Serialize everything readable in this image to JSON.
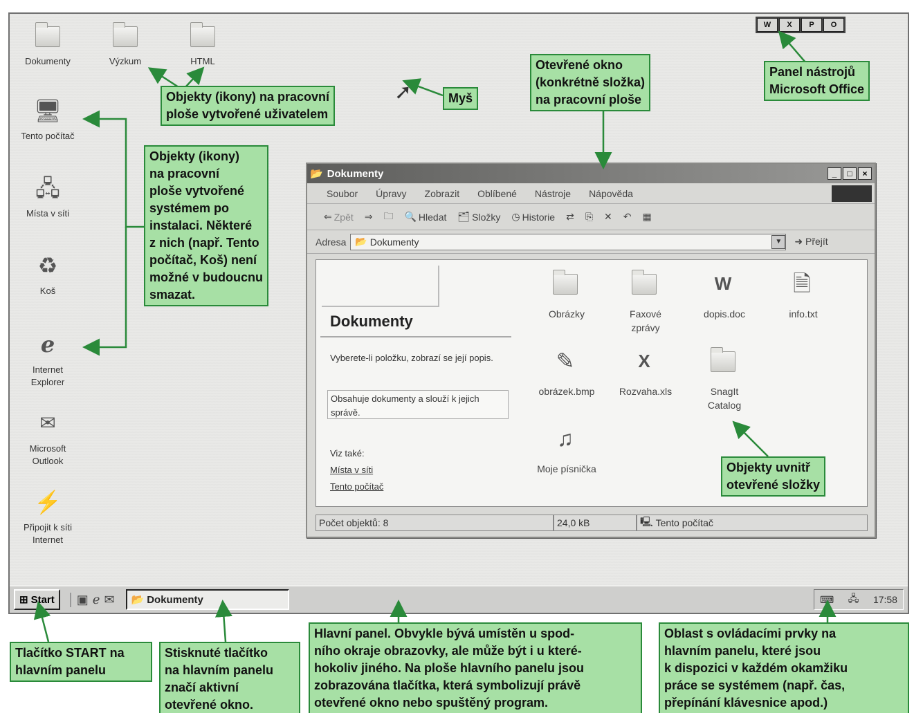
{
  "desktop_icons": [
    {
      "label": "Dokumenty",
      "icon": "folder-open-icon"
    },
    {
      "label": "Výzkum",
      "icon": "folder-icon"
    },
    {
      "label": "HTML",
      "icon": "folder-icon"
    },
    {
      "label": "Tento počítač",
      "icon": "computer-icon"
    },
    {
      "label": "Místa v síti",
      "icon": "network-icon"
    },
    {
      "label": "Koš",
      "icon": "recycle-bin-icon"
    },
    {
      "label": "Internet\nExplorer",
      "icon": "internet-explorer-icon"
    },
    {
      "label": "Microsoft\nOutlook",
      "icon": "outlook-icon"
    },
    {
      "label": "Připojit k síti\nInternet",
      "icon": "connect-internet-icon"
    }
  ],
  "office_toolbar": [
    "W",
    "X",
    "P",
    "O"
  ],
  "window": {
    "title": "Dokumenty",
    "menu": [
      "Soubor",
      "Úpravy",
      "Zobrazit",
      "Oblíbené",
      "Nástroje",
      "Nápověda"
    ],
    "toolbar": {
      "back": "Zpět",
      "search": "Hledat",
      "folders": "Složky",
      "history": "Historie"
    },
    "address_label": "Adresa",
    "address_value": "Dokumenty",
    "go_label": "Přejít",
    "left_pane": {
      "title": "Dokumenty",
      "hint": "Vyberete-li položku, zobrazí se její popis.",
      "description": "Obsahuje dokumenty a slouží k jejich správě.",
      "see_also": "Viz také:",
      "links": [
        "Místa v síti",
        "Tento počítač"
      ]
    },
    "items": [
      {
        "label": "Obrázky",
        "icon": "pictures-folder-icon"
      },
      {
        "label": "Faxové\nzprávy",
        "icon": "folder-icon"
      },
      {
        "label": "dopis.doc",
        "icon": "word-document-icon"
      },
      {
        "label": "info.txt",
        "icon": "text-file-icon"
      },
      {
        "label": "obrázek.bmp",
        "icon": "bitmap-image-icon"
      },
      {
        "label": "Rozvaha.xls",
        "icon": "excel-file-icon"
      },
      {
        "label": "SnagIt\nCatalog",
        "icon": "folder-icon"
      },
      {
        "label": "Moje písnička",
        "icon": "audio-file-icon"
      }
    ],
    "status": {
      "count": "Počet objektů: 8",
      "size": "24,0 kB",
      "location": "Tento počítač"
    }
  },
  "taskbar": {
    "start": "Start",
    "task": "Dokumenty",
    "clock": "17:58"
  },
  "callouts": {
    "user_icons": "Objekty (ikony) na pracovní\nploše vytvořené uživatelem",
    "mouse": "Myš",
    "open_window": "Otevřené okno\n(konkrétně složka)\nna pracovní ploše",
    "office_panel": "Panel nástrojů\nMicrosoft Office",
    "system_icons": "Objekty (ikony)\nna pracovní\nploše vytvořené\nsystémem po\ninstalaci. Některé\nz nich (např. Tento\npočítač, Koš) není\nmožné v budoucnu\nsmazat.",
    "folder_objects": "Objekty uvnitř\notevřené složky",
    "start_button": "Tlačítko START na\nhlavním panelu",
    "pressed_button": "Stisknuté tlačítko\nna hlavním panelu\nznačí aktivní\notevřené okno.",
    "main_panel": "Hlavní panel. Obvykle bývá umístěn u spod-\nního okraje obrazovky, ale může být i u které-\nhokoliv jiného. Na ploše hlavního panelu jsou\nzobrazována tlačítka, která symbolizují právě\notevřené okno nebo spuštěný program.",
    "tray_area": "Oblast s ovládacími prvky na\nhlavním panelu, které jsou\nk dispozici v každém okamžiku\npráce se systémem (např. čas,\npřepínání klávesnice apod.)"
  },
  "colors": {
    "callout_bg": "#a7e0a5",
    "callout_border": "#2a8a3a",
    "arrow": "#2a8a3a"
  }
}
